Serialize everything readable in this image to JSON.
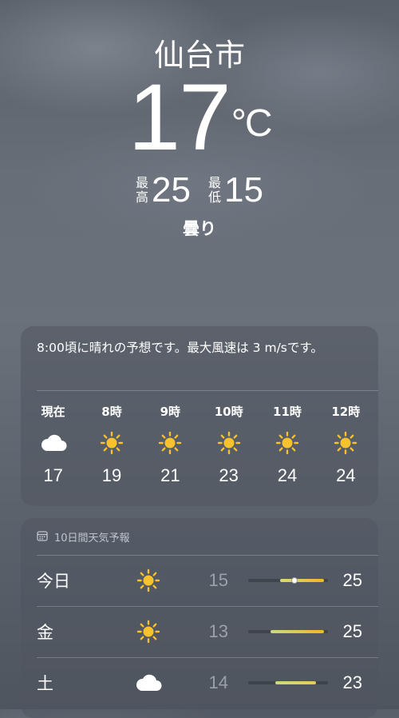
{
  "current": {
    "city": "仙台市",
    "temperature": "17",
    "unit": "°C",
    "high_label_top": "最",
    "high_label_bottom": "高",
    "high": "25",
    "low_label_top": "最",
    "low_label_bottom": "低",
    "low": "15",
    "condition": "曇り"
  },
  "hourly": {
    "summary": "8:00頃に晴れの予想です。最大風速は 3 m/sです。",
    "items": [
      {
        "time": "現在",
        "icon": "cloud-icon",
        "temp": "17"
      },
      {
        "time": "8時",
        "icon": "sun-icon",
        "temp": "19"
      },
      {
        "time": "9時",
        "icon": "sun-icon",
        "temp": "21"
      },
      {
        "time": "10時",
        "icon": "sun-icon",
        "temp": "23"
      },
      {
        "time": "11時",
        "icon": "sun-icon",
        "temp": "24"
      },
      {
        "time": "12時",
        "icon": "sun-icon",
        "temp": "24"
      }
    ]
  },
  "daily": {
    "header": "10日間天気予報",
    "header_icon": "calendar-icon",
    "items": [
      {
        "day": "今日",
        "icon": "sun-icon",
        "low": "15",
        "high": "25",
        "range_start": 0.4,
        "range_end": 0.95,
        "current_marker": 0.58
      },
      {
        "day": "金",
        "icon": "sun-icon",
        "low": "13",
        "high": "25",
        "range_start": 0.28,
        "range_end": 0.95
      },
      {
        "day": "土",
        "icon": "cloud-icon",
        "low": "14",
        "high": "23",
        "range_start": 0.34,
        "range_end": 0.85
      }
    ]
  },
  "colors": {
    "sun": "#f7c22c",
    "bar_warm": "#f3b623",
    "bar_cool": "#c9d985"
  }
}
